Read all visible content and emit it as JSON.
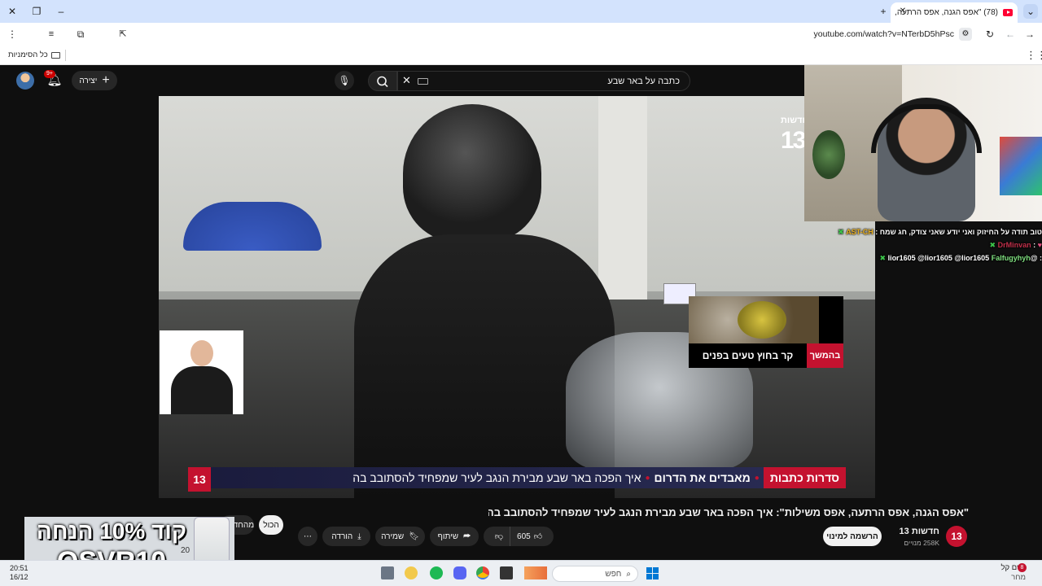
{
  "browser": {
    "tab_title": "(78) \"אפס הגנה, אפס הרתעה,",
    "url": "youtube.com/watch?v=NTerbD5hPsc",
    "bookmarks_label": "כל הסימניות"
  },
  "youtube": {
    "search_query": "כתבה על באר שבע",
    "create_label": "יצירה",
    "notifications_count": "9+"
  },
  "video": {
    "channel_logo": "13",
    "watermark_line": "חדשות",
    "up_next_label": "בהמשך",
    "up_next_title": "קר בחוץ טעים בפנים",
    "banner_series": "סדרות כתבות",
    "banner_program": "מאבדים את הדרום",
    "banner_headline": "איך הפכה באר שבע מבירת הנגב לעיר שמפחיד להסתובב בה"
  },
  "chat": {
    "lines": [
      {
        "user": "AST-CH",
        "text": "טוב תודה על החיזוק ואני יודע שאני צודק, חג שמח :"
      },
      {
        "user": "DrMinvan",
        "text": ":"
      },
      {
        "user": "Falfugyhyh",
        "text": ": @lior1605 @lior1605 @lior1605"
      }
    ]
  },
  "watch": {
    "title": "\"אפס הגנה, אפס הרתעה, אפס משילות\": איך הפכה באר שבע מבירת הנגב לעיר שמפחיד להסתובב בה?",
    "channel_name": "חדשות 13",
    "subscribers": "258K מנויים",
    "subscribe_label": "הרשמה למינוי",
    "like_count": "605",
    "share_label": "שיתוף",
    "save_label": "שמירה",
    "download_label": "הורדה",
    "filter_all": "הכול",
    "filter_from_channel": "מהחדשות"
  },
  "promo": {
    "line1": "קוד 10% הנחה",
    "line2": "OSVR10",
    "small_text": "20"
  },
  "taskbar": {
    "time": "20:51",
    "date": "16/12",
    "search_placeholder": "חפש",
    "weather_title": "גשם קל",
    "weather_sub": "מחר",
    "weather_badge": "8"
  }
}
